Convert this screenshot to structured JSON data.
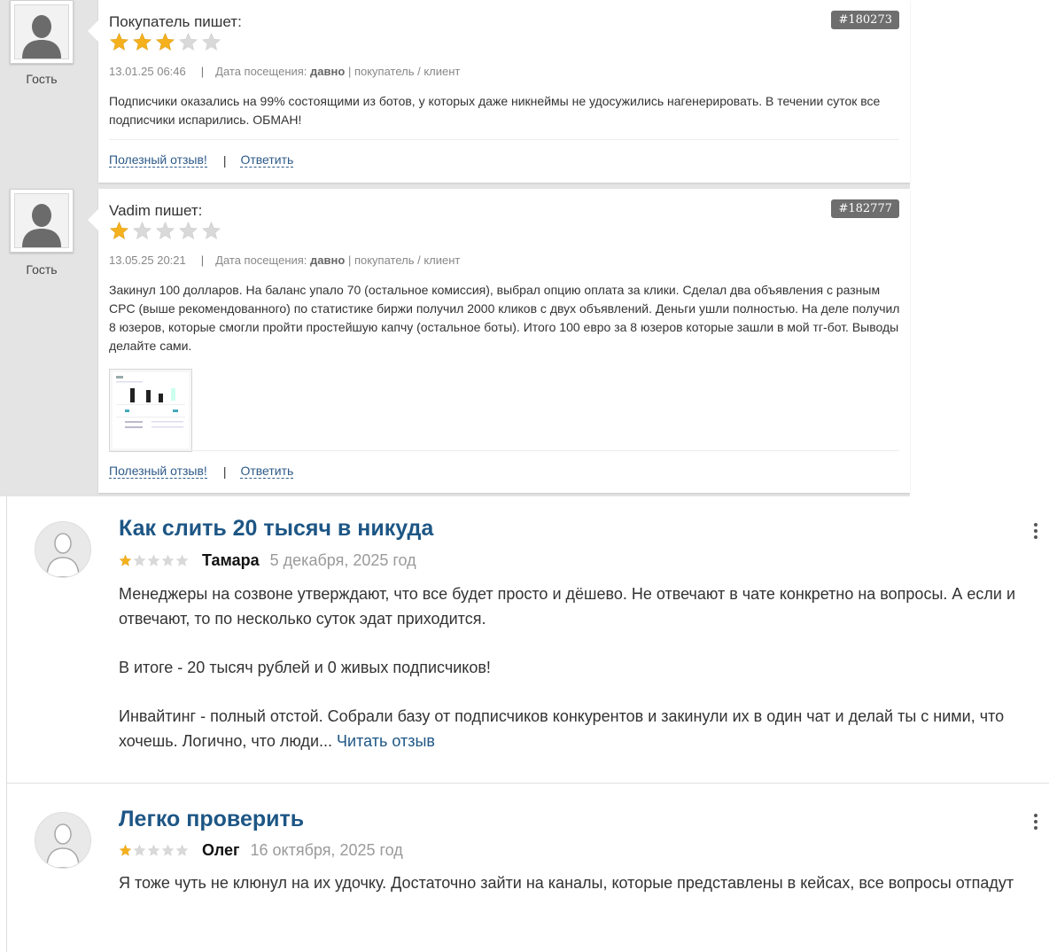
{
  "forum_reviews": [
    {
      "author_line": "Покупатель пишет:",
      "id": "#180273",
      "rating": 3,
      "max_rating": 5,
      "guest_label": "Гость",
      "date": "13.01.25 06:46",
      "visit_label": "Дата посещения:",
      "visit_value": "давно",
      "role": "| покупатель / клиент",
      "text": "Подписчики оказались на 99% состоящими из ботов, у которых даже никнеймы не удосужились нагенерировать. В течении суток все подписчики испарились. ОБМАН!",
      "helpful_label": "Полезный отзыв!",
      "reply_label": "Ответить",
      "has_attachment": false
    },
    {
      "author_line": "Vadim пишет:",
      "id": "#182777",
      "rating": 1,
      "max_rating": 5,
      "guest_label": "Гость",
      "date": "13.05.25 20:21",
      "visit_label": "Дата посещения:",
      "visit_value": "давно",
      "role": "| покупатель / клиент",
      "text": "Закинул 100 долларов. На баланс упало 70 (остальное комиссия), выбрал опцию оплата за клики. Сделал два объявления с разным CPC (выше рекомендованного) по статистике биржи получил 2000 кликов с двух объявлений. Деньги ушли полностью. На деле получил 8 юзеров, которые смогли пройти простейшую капчу (остальное боты). Итого 100 евро за 8 юзеров которые зашли в мой тг-бот. Выводы делайте сами.",
      "helpful_label": "Полезный отзыв!",
      "reply_label": "Ответить",
      "has_attachment": true
    }
  ],
  "site_reviews": [
    {
      "title": "Как слить 20 тысяч в никуда",
      "rating": 1,
      "max_rating": 5,
      "author": "Тамара",
      "date": "5 декабря, 2025 год",
      "paragraphs": [
        "Менеджеры на созвоне утверждают, что все будет просто и дёшево. Не отвечают в чате конкретно на вопросы. А если и отвечают, то по несколько суток эдат приходится.",
        "В итоге - 20 тысяч рублей и 0 живых подписчиков!",
        "Инвайтинг - полный отстой. Собрали базу от подписчиков конкурентов и закинули их в один чат и делай ты с ними, что хочешь. Логично, что люди..."
      ],
      "read_more": "Читать отзыв"
    },
    {
      "title": "Легко проверить",
      "rating": 1,
      "max_rating": 5,
      "author": "Олег",
      "date": "16 октября, 2025 год",
      "paragraphs": [
        "Я тоже чуть не клюнул на их удочку. Достаточно зайти на каналы, которые представлены в кейсах, все вопросы отпадут"
      ],
      "read_more": ""
    }
  ],
  "colors": {
    "star_filled": "#f5b11d",
    "star_empty": "#d9d9d9",
    "link": "#2d5a88",
    "title": "#1d5685",
    "badge_bg": "#6e6e6e",
    "panel_bg": "#e4e4e4"
  },
  "icons": {
    "avatar": "user-silhouette-icon",
    "star": "star-icon",
    "menu": "kebab-menu-icon"
  }
}
